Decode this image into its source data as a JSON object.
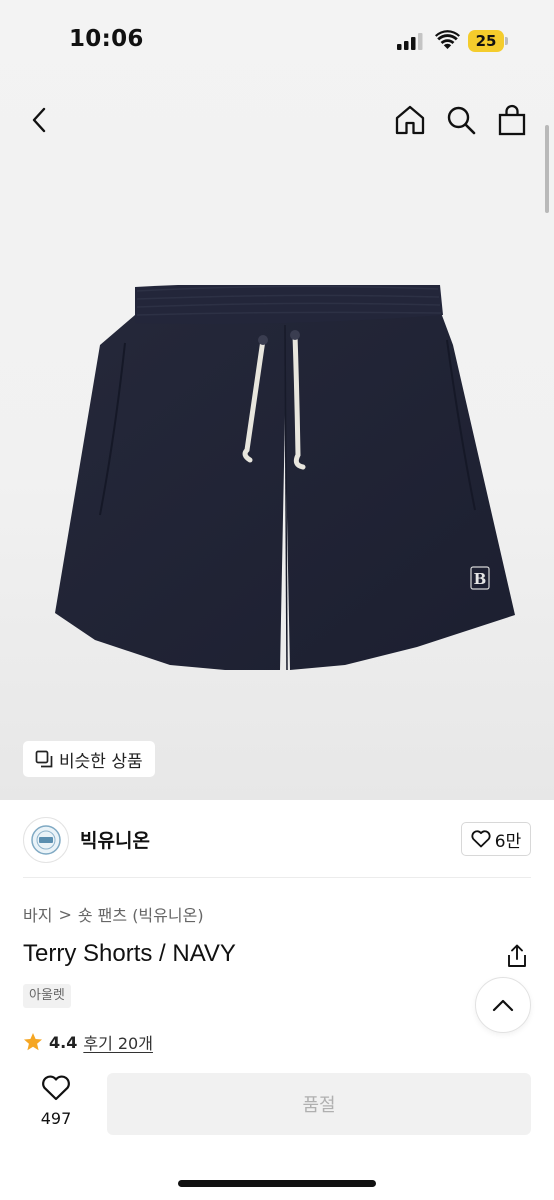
{
  "status_bar": {
    "time": "10:06",
    "battery": "25",
    "battery_color": "#f4cc2c"
  },
  "nav": {
    "back_icon": "chevron-left-icon",
    "home_icon": "home-icon",
    "search_icon": "search-icon",
    "bag_icon": "shopping-bag-icon"
  },
  "product_image": {
    "description_icon": "product-photo",
    "logo_letter": "B"
  },
  "similar": {
    "label": "비슷한 상품"
  },
  "brand": {
    "name": "빅유니온",
    "likes": "6만"
  },
  "breadcrumb": {
    "category": "바지",
    "separator": ">",
    "subcategory": "숏 팬츠 (빅유니온)"
  },
  "product": {
    "title": "Terry Shorts / NAVY",
    "tag": "아울렛",
    "rating": "4.4",
    "reviews": "후기 20개",
    "star_color": "#f5a623"
  },
  "actions": {
    "wish_count": "497",
    "buy_label": "품절"
  }
}
